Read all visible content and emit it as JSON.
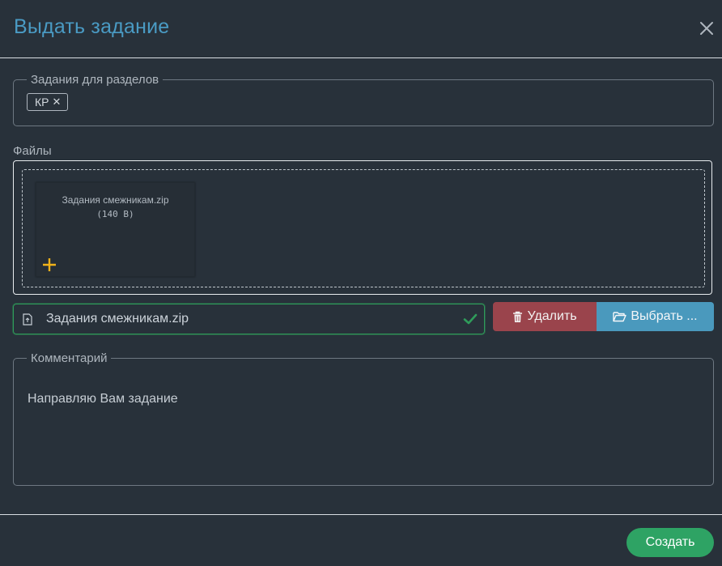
{
  "dialog": {
    "title": "Выдать задание",
    "close_icon": "close-icon"
  },
  "sections": {
    "legend": "Задания для разделов",
    "tags": [
      {
        "label": "КР",
        "remove_icon": "remove-tag-icon"
      }
    ]
  },
  "files": {
    "label": "Файлы",
    "preview": {
      "name": "Задания смежникам.zip",
      "size": "(140 B)",
      "add_icon": "plus-icon"
    },
    "input": {
      "file_icon": "file-upload-icon",
      "value": "Задания смежникам.zip",
      "valid_icon": "check-icon"
    },
    "delete_button": {
      "label": "Удалить",
      "icon": "trash-icon"
    },
    "choose_button": {
      "label": "Выбрать ...",
      "icon": "folder-open-icon"
    }
  },
  "comment": {
    "legend": "Комментарий",
    "value": "Направляю Вам задание"
  },
  "footer": {
    "create_label": "Создать"
  },
  "colors": {
    "background": "#28313a",
    "title": "#4a9bc4",
    "delete": "#9a444c",
    "choose": "#4a99bd",
    "create": "#2ea364",
    "valid": "#2f9c5a",
    "plus": "#f0b21a"
  }
}
